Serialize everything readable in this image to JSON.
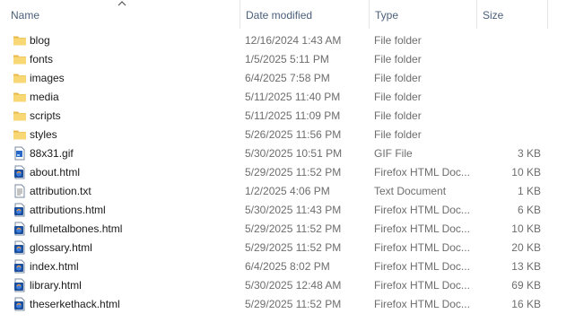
{
  "columns": {
    "name": "Name",
    "date": "Date modified",
    "type": "Type",
    "size": "Size"
  },
  "sort_indicator": "chevron-up-icon",
  "colors": {
    "header_text": "#4c607a",
    "folder_fill": "#f8d775",
    "html_icon_blue": "#1b4f9c"
  },
  "files": [
    {
      "name": "blog",
      "date": "12/16/2024 1:43 AM",
      "type": "File folder",
      "size": "",
      "icon": "folder"
    },
    {
      "name": "fonts",
      "date": "1/5/2025 5:11 PM",
      "type": "File folder",
      "size": "",
      "icon": "folder"
    },
    {
      "name": "images",
      "date": "6/4/2025 7:58 PM",
      "type": "File folder",
      "size": "",
      "icon": "folder"
    },
    {
      "name": "media",
      "date": "5/11/2025 11:40 PM",
      "type": "File folder",
      "size": "",
      "icon": "folder"
    },
    {
      "name": "scripts",
      "date": "5/11/2025 11:09 PM",
      "type": "File folder",
      "size": "",
      "icon": "folder"
    },
    {
      "name": "styles",
      "date": "5/26/2025 11:56 PM",
      "type": "File folder",
      "size": "",
      "icon": "folder"
    },
    {
      "name": "88x31.gif",
      "date": "5/30/2025 10:51 PM",
      "type": "GIF File",
      "size": "3 KB",
      "icon": "gif"
    },
    {
      "name": "about.html",
      "date": "5/29/2025 11:52 PM",
      "type": "Firefox HTML Doc...",
      "size": "10 KB",
      "icon": "html"
    },
    {
      "name": "attribution.txt",
      "date": "1/2/2025 4:06 PM",
      "type": "Text Document",
      "size": "1 KB",
      "icon": "txt"
    },
    {
      "name": "attributions.html",
      "date": "5/30/2025 11:43 PM",
      "type": "Firefox HTML Doc...",
      "size": "6 KB",
      "icon": "html"
    },
    {
      "name": "fullmetalbones.html",
      "date": "5/29/2025 11:52 PM",
      "type": "Firefox HTML Doc...",
      "size": "10 KB",
      "icon": "html"
    },
    {
      "name": "glossary.html",
      "date": "5/29/2025 11:52 PM",
      "type": "Firefox HTML Doc...",
      "size": "20 KB",
      "icon": "html"
    },
    {
      "name": "index.html",
      "date": "6/4/2025 8:02 PM",
      "type": "Firefox HTML Doc...",
      "size": "13 KB",
      "icon": "html"
    },
    {
      "name": "library.html",
      "date": "5/30/2025 12:48 AM",
      "type": "Firefox HTML Doc...",
      "size": "69 KB",
      "icon": "html"
    },
    {
      "name": "theserkethack.html",
      "date": "5/29/2025 11:52 PM",
      "type": "Firefox HTML Doc...",
      "size": "16 KB",
      "icon": "html"
    }
  ]
}
